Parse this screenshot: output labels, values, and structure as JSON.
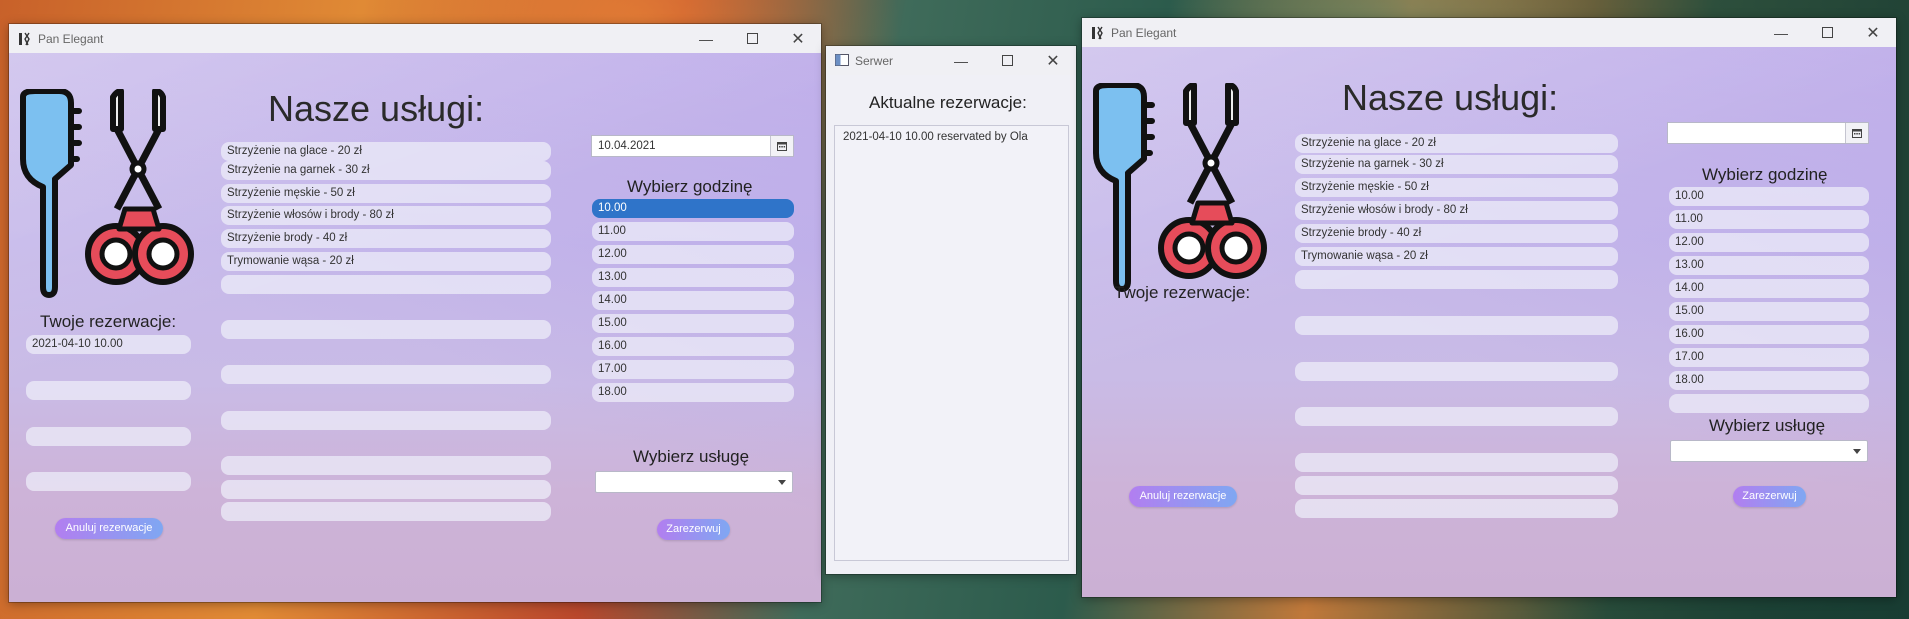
{
  "windows": {
    "client_left": {
      "title": "Pan Elegant",
      "heading": "Nasze usługi:",
      "services": [
        "Strzyżenie na glace - 20 zł",
        "Strzyżenie na garnek - 30 zł",
        "Strzyżenie męskie - 50 zł",
        "Strzyżenie włosów i brody - 80 zł",
        "Strzyżenie brody - 40 zł",
        "Trymowanie wąsa - 20 zł"
      ],
      "date_value": "10.04.2021",
      "choose_hour_label": "Wybierz godzinę",
      "hours": [
        "10.00",
        "11.00",
        "12.00",
        "13.00",
        "14.00",
        "15.00",
        "16.00",
        "17.00",
        "18.00"
      ],
      "selected_hour": "10.00",
      "reservations_label": "Twoje rezerwacje:",
      "reservations": [
        "2021-04-10 10.00"
      ],
      "choose_service_label": "Wybierz usługę",
      "cancel_button": "Anuluj rezerwacje",
      "reserve_button": "Zarezerwuj"
    },
    "server": {
      "title": "Serwer",
      "heading": "Aktualne rezerwacje:",
      "entries": [
        "2021-04-10 10.00 reservated by Ola"
      ]
    },
    "client_right": {
      "title": "Pan Elegant",
      "heading": "Nasze usługi:",
      "services": [
        "Strzyżenie na glace - 20 zł",
        "Strzyżenie na garnek - 30 zł",
        "Strzyżenie męskie - 50 zł",
        "Strzyżenie włosów i brody - 80 zł",
        "Strzyżenie brody - 40 zł",
        "Trymowanie wąsa - 20 zł"
      ],
      "date_value": "",
      "choose_hour_label": "Wybierz godzinę",
      "hours": [
        "10.00",
        "11.00",
        "12.00",
        "13.00",
        "14.00",
        "15.00",
        "16.00",
        "17.00",
        "18.00"
      ],
      "reservations_label": "Twoje rezerwacje:",
      "choose_service_label": "Wybierz usługę",
      "cancel_button": "Anuluj rezerwacje",
      "reserve_button": "Zarezerwuj"
    }
  },
  "icons": {
    "app": "scissors-comb-icon",
    "calendar": "calendar-icon",
    "minimize": "minimize-icon",
    "maximize": "maximize-icon",
    "close": "close-icon",
    "combo_arrow": "chevron-down-icon",
    "illustration": "comb-and-scissors-illustration"
  },
  "colors": {
    "selection": "#2f74c9",
    "button_gradient_start": "#b27ef0",
    "button_gradient_end": "#7fa7f2",
    "client_background": "#c6b9ea"
  }
}
